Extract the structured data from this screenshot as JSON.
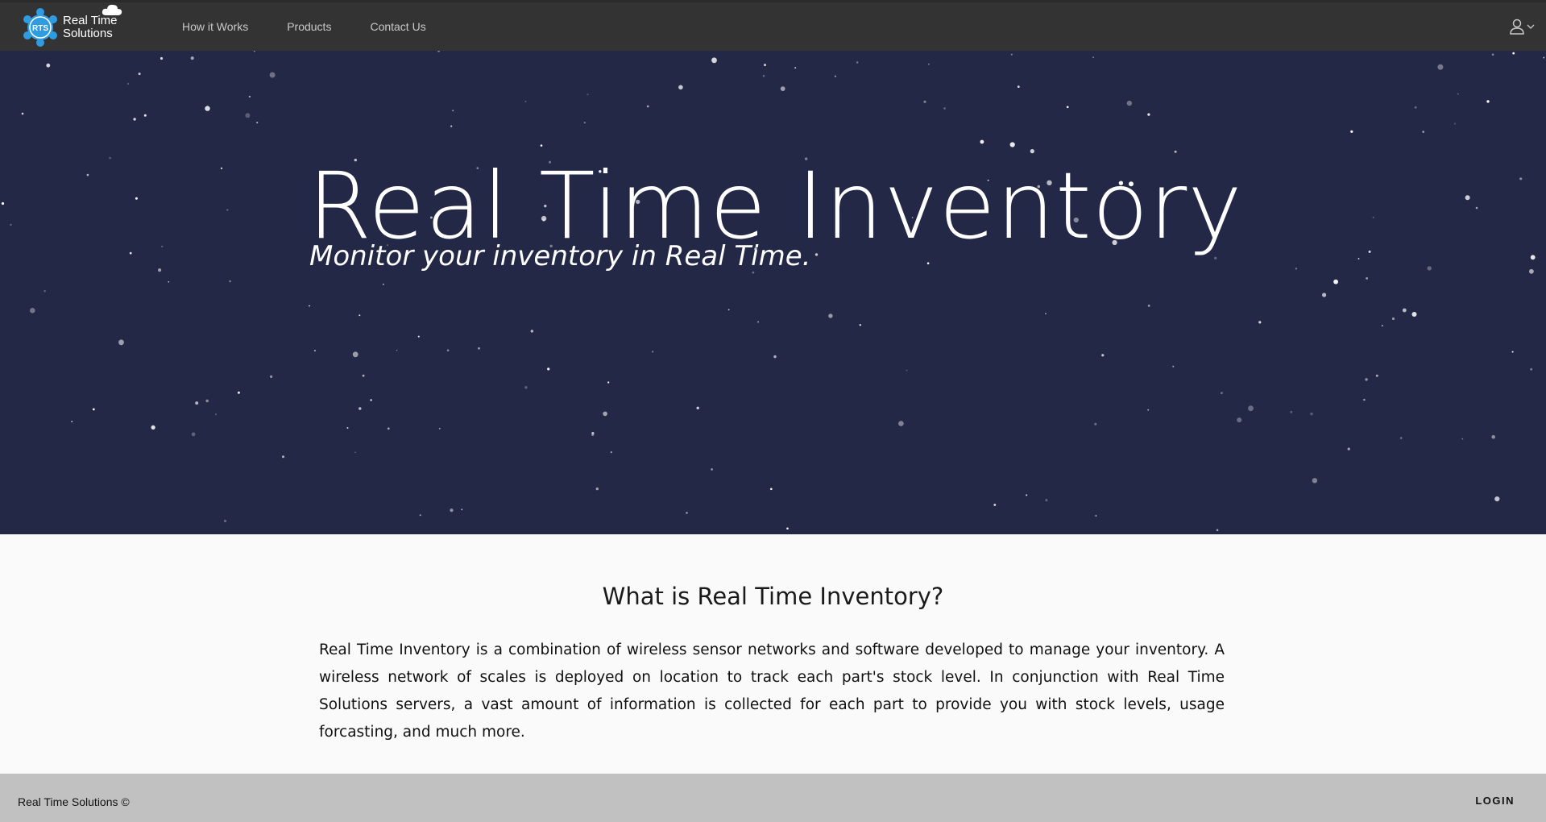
{
  "navbar": {
    "brand": {
      "logo_text": "RTS",
      "line1": "Real Time",
      "line2": "Solutions"
    },
    "links": [
      {
        "label": "How it Works"
      },
      {
        "label": "Products"
      },
      {
        "label": "Contact Us"
      }
    ],
    "user_icon": "user-icon",
    "dropdown_icon": "chevron-down-icon",
    "colors": {
      "background": "#333333",
      "logo_blue": "#2f9be0"
    }
  },
  "hero": {
    "title": "Real Time Inventory",
    "subtitle": "Monitor your inventory in Real Time.",
    "colors": {
      "background": "#232846"
    }
  },
  "section": {
    "title": "What is Real Time Inventory?",
    "body": "Real Time Inventory is a combination of wireless sensor networks and software developed to manage your inventory. A wireless network of scales is deployed on location to track each part's stock level. In conjunction with Real Time Solutions servers, a vast amount of information is collected for each part to provide you with stock levels, usage forcasting, and much more."
  },
  "footer": {
    "copyright": "Real Time Solutions ©",
    "login_label": "LOGIN",
    "colors": {
      "background": "#c1c1c1"
    }
  }
}
